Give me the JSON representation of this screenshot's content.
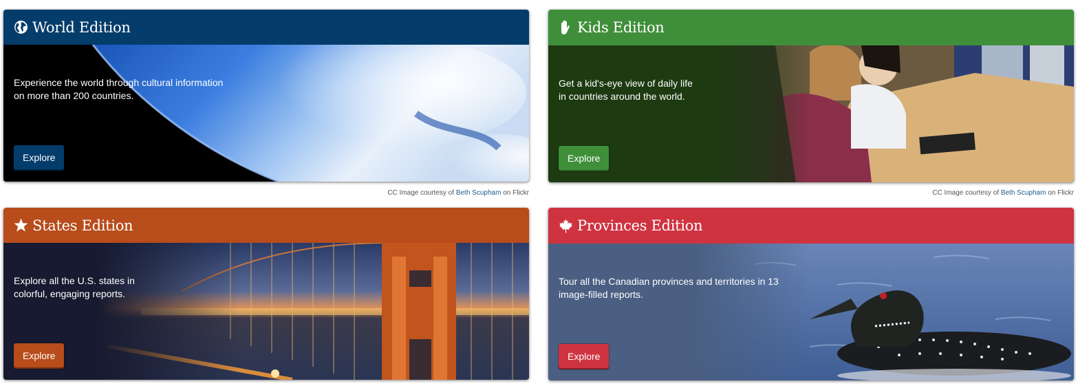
{
  "cards": [
    {
      "title": "World Edition",
      "icon": "globe-icon",
      "description": "Experience the world through cultural information on more than 200 countries.",
      "button": "Explore",
      "color": "#043c6b",
      "credit": {
        "prefix": "CC Image courtesy of",
        "author": "Beth Scupham",
        "suffix": "on Flickr"
      }
    },
    {
      "title": "Kids Edition",
      "icon": "hand-icon",
      "description": "Get a kid's-eye view of daily life in countries around the world.",
      "button": "Explore",
      "color": "#3f8f3a",
      "credit": {
        "prefix": "CC Image courtesy of",
        "author": "Beth Scupham",
        "suffix": "on Flickr"
      }
    },
    {
      "title": "States Edition",
      "icon": "star-icon",
      "description": "Explore all the U.S. states in colorful, engaging reports.",
      "button": "Explore",
      "color": "#b84c1b"
    },
    {
      "title": "Provinces Edition",
      "icon": "maple-leaf-icon",
      "description": "Tour all the Canadian provinces and territories in 13 image-filled reports.",
      "button": "Explore",
      "color": "#cf3340"
    }
  ]
}
